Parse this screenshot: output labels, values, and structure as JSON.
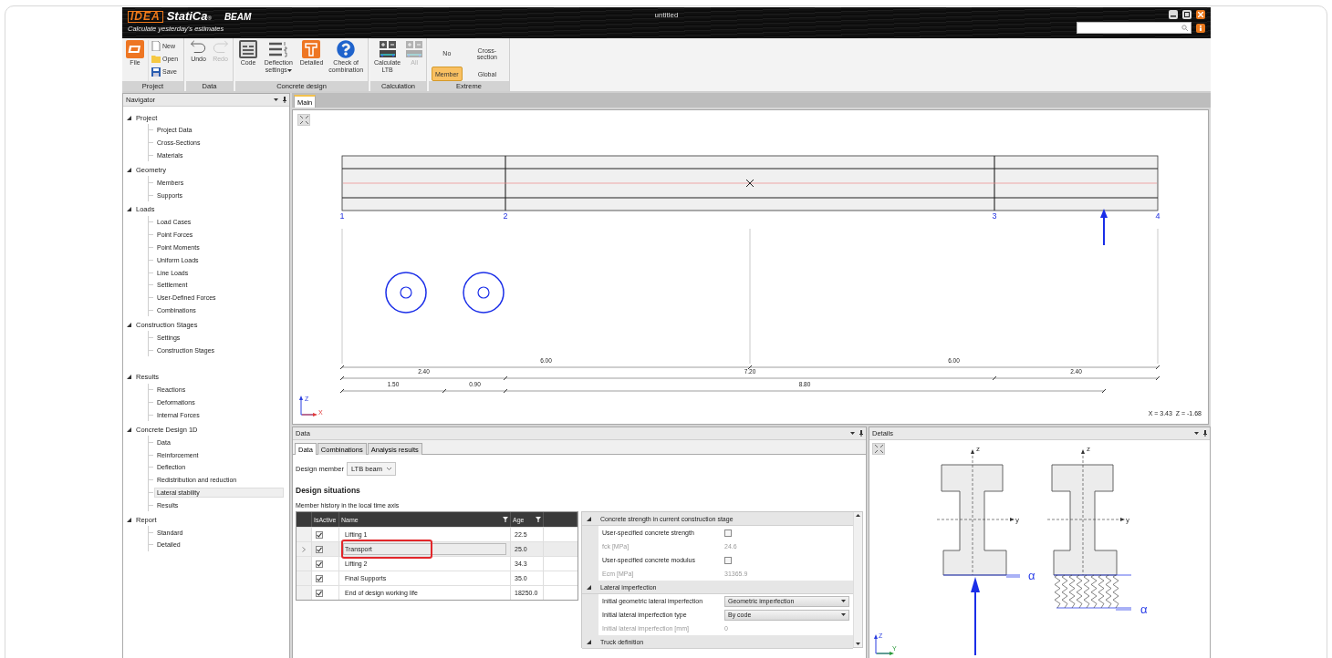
{
  "window": {
    "logo": "IDEA",
    "brand": "StatiCa",
    "mark": "®",
    "module": "BEAM",
    "tagline": "Calculate yesterday's estimates",
    "title": "untitled"
  },
  "ribbon": {
    "groups": [
      {
        "label": "Project",
        "items": [
          {
            "kind": "large",
            "label": "File",
            "disabled": false,
            "dropdown": false
          },
          {
            "kind": "stack",
            "entries": [
              {
                "label": "New"
              },
              {
                "label": "Open"
              },
              {
                "label": "Save"
              }
            ]
          }
        ]
      },
      {
        "label": "Data",
        "items": [
          {
            "kind": "large",
            "label": "Undo",
            "disabled": false,
            "dropdown": false
          },
          {
            "kind": "large",
            "label": "Redo",
            "disabled": true,
            "dropdown": false
          }
        ]
      },
      {
        "label": "Concrete design",
        "items": [
          {
            "kind": "large",
            "label": "Code",
            "disabled": false,
            "dropdown": false
          },
          {
            "kind": "large",
            "label": "Deflection settings",
            "disabled": false,
            "dropdown": true
          },
          {
            "kind": "large",
            "label": "Detailed",
            "disabled": false,
            "dropdown": false
          },
          {
            "kind": "large",
            "label": "Check of combination",
            "disabled": false,
            "dropdown": false
          }
        ]
      },
      {
        "label": "Calculation",
        "items": [
          {
            "kind": "large",
            "label": "Calculate LTB",
            "disabled": false,
            "dropdown": false
          },
          {
            "kind": "large",
            "label": "All",
            "disabled": true,
            "dropdown": false
          }
        ]
      },
      {
        "label": "Extreme",
        "items": [
          {
            "kind": "options",
            "options": [
              {
                "label": "No",
                "selected": false
              },
              {
                "label": "Cross-section",
                "selected": false
              },
              {
                "label": "Member",
                "selected": true
              },
              {
                "label": "Global",
                "selected": false
              }
            ]
          }
        ]
      }
    ]
  },
  "navigator": {
    "title": "Navigator",
    "items": [
      {
        "label": "Project",
        "expanded": true,
        "selected": false,
        "children": [
          {
            "label": "Project Data",
            "selected": false
          },
          {
            "label": "Cross-Sections",
            "selected": false
          },
          {
            "label": "Materials",
            "selected": false
          }
        ]
      },
      {
        "label": "Geometry",
        "expanded": true,
        "selected": false,
        "children": [
          {
            "label": "Members",
            "selected": false
          },
          {
            "label": "Supports",
            "selected": false
          }
        ]
      },
      {
        "label": "Loads",
        "expanded": true,
        "selected": false,
        "children": [
          {
            "label": "Load Cases",
            "selected": false
          },
          {
            "label": "Point Forces",
            "selected": false
          },
          {
            "label": "Point Moments",
            "selected": false
          },
          {
            "label": "Uniform Loads",
            "selected": false
          },
          {
            "label": "Line Loads",
            "selected": false
          },
          {
            "label": "Settlement",
            "selected": false
          },
          {
            "label": "User-Defined Forces",
            "selected": false
          },
          {
            "label": "Combinations",
            "selected": false
          }
        ]
      },
      {
        "label": "Construction Stages",
        "expanded": true,
        "selected": false,
        "children": [
          {
            "label": "Settings",
            "selected": false
          },
          {
            "label": "Construction Stages",
            "selected": false
          }
        ]
      },
      {
        "label": "Results",
        "expanded": true,
        "selected": false,
        "children": [
          {
            "label": "Reactions",
            "selected": false
          },
          {
            "label": "Deformations",
            "selected": false
          },
          {
            "label": "Internal Forces",
            "selected": false
          }
        ]
      },
      {
        "label": "Concrete Design 1D",
        "expanded": true,
        "selected": false,
        "children": [
          {
            "label": "Data",
            "selected": false
          },
          {
            "label": "Reinforcement",
            "selected": false
          },
          {
            "label": "Deflection",
            "selected": false
          },
          {
            "label": "Redistribution and reduction",
            "selected": false
          },
          {
            "label": "Lateral stability",
            "selected": true
          },
          {
            "label": "Results",
            "selected": false
          }
        ]
      },
      {
        "label": "Report",
        "expanded": true,
        "selected": false,
        "children": [
          {
            "label": "Standard",
            "selected": false
          },
          {
            "label": "Detailed",
            "selected": false
          }
        ]
      }
    ]
  },
  "document_tabs": [
    {
      "label": "Main",
      "selected": true
    }
  ],
  "canvas": {
    "node_labels": [
      "1",
      "2",
      "3",
      "4"
    ],
    "dimension_rows": [
      [
        "6.00",
        "6.00"
      ],
      [
        "2.40",
        "7.20",
        "2.40"
      ],
      [
        "1.50",
        "0.90",
        "8.80"
      ]
    ],
    "axis_z": "Z",
    "axis_x": "X",
    "cursor": "X = 3.43  Z = -1.68"
  },
  "data_panel": {
    "title": "Data",
    "tabs": [
      {
        "label": "Data",
        "selected": true
      },
      {
        "label": "Combinations",
        "selected": false
      },
      {
        "label": "Analysis results",
        "selected": false
      }
    ],
    "design_member": {
      "label": "Design member",
      "value": "LTB beam"
    },
    "heading": "Design situations",
    "subtitle": "Member history in the local time axis",
    "table": {
      "columns": [
        "IsActive",
        "Name",
        "Age"
      ],
      "rows": [
        {
          "active": true,
          "name": "Lifting 1",
          "age": "22.5",
          "selected": false,
          "highlighted": false
        },
        {
          "active": true,
          "name": "Transport",
          "age": "25.0",
          "selected": true,
          "highlighted": true
        },
        {
          "active": true,
          "name": "Lifting 2",
          "age": "34.3",
          "selected": false,
          "highlighted": false
        },
        {
          "active": true,
          "name": "Final Supports",
          "age": "35.0",
          "selected": false,
          "highlighted": false
        },
        {
          "active": true,
          "name": "End of design working life",
          "age": "18250.0",
          "selected": false,
          "highlighted": false
        }
      ]
    },
    "properties": [
      {
        "title": "Concrete strength in current construction stage",
        "expanded": true,
        "rows": [
          {
            "kind": "checkbox",
            "label": "User-specified concrete strength",
            "checked": false
          },
          {
            "kind": "readonly",
            "label": "fck [MPa]",
            "value": "24.6"
          },
          {
            "kind": "checkbox",
            "label": "User-specified concrete modulus",
            "checked": false
          },
          {
            "kind": "readonly",
            "label": "Ecm [MPa]",
            "value": "31365.9"
          }
        ]
      },
      {
        "title": "Lateral imperfection",
        "expanded": true,
        "rows": [
          {
            "kind": "select",
            "label": "Initial geometric lateral imperfection",
            "value": "Geometric imperfection"
          },
          {
            "kind": "select",
            "label": "Initial lateral imperfection type",
            "value": "By code"
          },
          {
            "kind": "readonly",
            "label": "Initial lateral imperfection [mm]",
            "value": "0"
          }
        ]
      },
      {
        "title": "Truck definition",
        "expanded": true
      }
    ]
  },
  "details_panel": {
    "title": "Details",
    "axis_labels": [
      "z",
      "y",
      "z",
      "y"
    ],
    "alpha_labels": [
      "α",
      "α"
    ],
    "axis_z": "Z",
    "axis_y": "Y"
  }
}
